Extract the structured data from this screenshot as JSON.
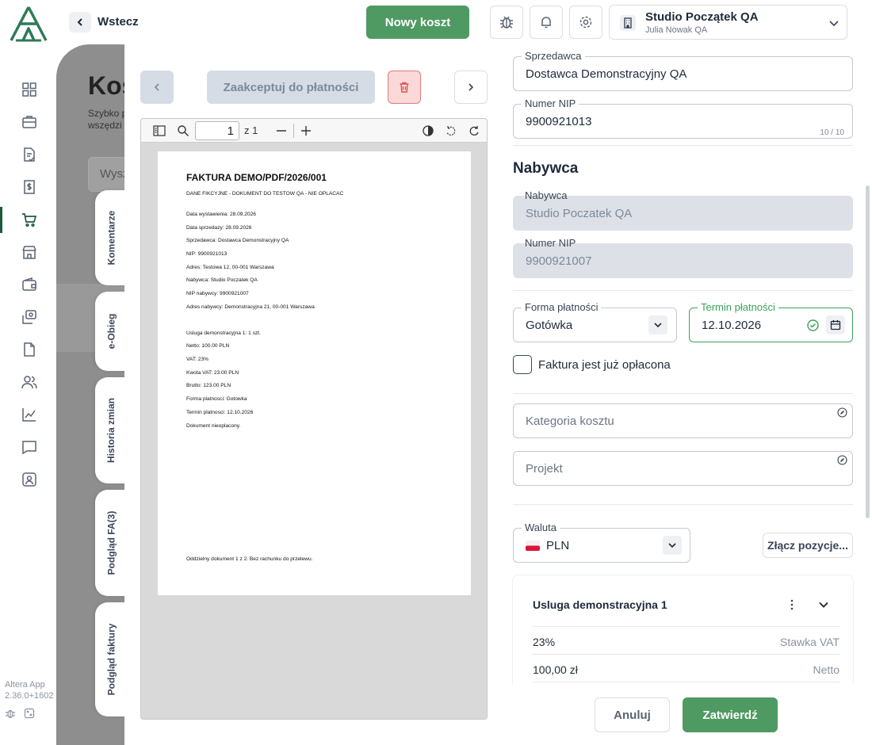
{
  "header": {
    "back_label": "Wstecz",
    "new_cost_label": "Nowy koszt",
    "company_name": "Studio Początek QA",
    "user_name": "Julia Nowak QA",
    "icons": [
      "bug-icon",
      "bell-icon",
      "gear-icon",
      "building-icon",
      "chevron-down-icon"
    ]
  },
  "nav": {
    "icons": [
      "grid-icon",
      "briefcase-icon",
      "document-check-icon",
      "receipt-dollar-icon",
      "cart-icon",
      "store-icon",
      "wallet-icon",
      "cash-icon",
      "file-icon",
      "users-icon",
      "chart-icon",
      "chat-icon",
      "contact-icon"
    ],
    "active": "cart-icon",
    "app_name": "Altera App",
    "version": "2.36.0+1602"
  },
  "background": {
    "title": "Kos",
    "subtitle_line1": "Szybko p",
    "subtitle_line2": "wszędzi",
    "search_placeholder": "Wysz"
  },
  "side_tabs": [
    "Komentarze",
    "e-Obieg",
    "Historia zmian",
    "Podgląd FA(3)",
    "Podgląd faktury"
  ],
  "toolbar": {
    "accept_label": "Zaakceptuj do płatności"
  },
  "viewer": {
    "page_value": "1",
    "page_total": "z 1"
  },
  "invoice": {
    "title": "FAKTURA DEMO/PDF/2026/001",
    "lines": [
      "DANE FIKCYJNE - DOKUMENT DO TESTOW QA - NIE OPLACAC",
      "Data wystawienia: 28.09.2026",
      "Data sprzedazy: 28.09.2026",
      "Sprzedawca: Dostawca Demonstracyjny QA",
      "NIP: 9900921013",
      "Adres: Testowa 12, 00-001 Warszawa",
      "Nabywca: Studio Poczatek QA",
      "NIP nabywcy: 9900921007",
      "Adres nabywcy: Demonstracyjna 21, 00-001 Warszawa",
      "Usluga demonstracyjna 1: 1 szt.",
      "Netto: 100.00 PLN",
      "VAT: 23%",
      "Kwota VAT: 23.00 PLN",
      "Brutto: 123.00 PLN",
      "Forma platnosci: Gotowka",
      "Termin platnosci: 12.10.2026",
      "Dokument nieoplacony.",
      "Oddzielny dokument 1 z 2. Bez rachunku do przelewu."
    ]
  },
  "form": {
    "seller_label": "Sprzedawca",
    "seller_value": "Dostawca Demonstracyjny QA",
    "seller_nip_label": "Numer NIP",
    "seller_nip_value": "9900921013",
    "seller_nip_counter": "10 / 10",
    "buyer_heading": "Nabywca",
    "buyer_label": "Nabywca",
    "buyer_value": "Studio Poczatek QA",
    "buyer_nip_label": "Numer NIP",
    "buyer_nip_value": "9900921007",
    "payment_form_label": "Forma płatności",
    "payment_form_value": "Gotówka",
    "due_label": "Termin płatności",
    "due_value": "12.10.2026",
    "paid_label": "Faktura jest już opłacona",
    "category_placeholder": "Kategoria kosztu",
    "project_placeholder": "Projekt",
    "currency_label": "Waluta",
    "currency_value": "PLN",
    "merge_label": "Złącz pozycje...",
    "item_name": "Usluga demonstracyjna 1",
    "vat_rate": "23%",
    "vat_rate_label": "Stawka VAT",
    "net_value": "100,00 zł",
    "net_label": "Netto"
  },
  "footer": {
    "cancel_label": "Anuluj",
    "confirm_label": "Zatwierdź"
  },
  "colors": {
    "primary": "#4f9a63",
    "overlay": "#8e8e8e",
    "delete_bg": "#fbd9d9",
    "delete_icon": "#e05252",
    "success": "#3aa35c"
  }
}
